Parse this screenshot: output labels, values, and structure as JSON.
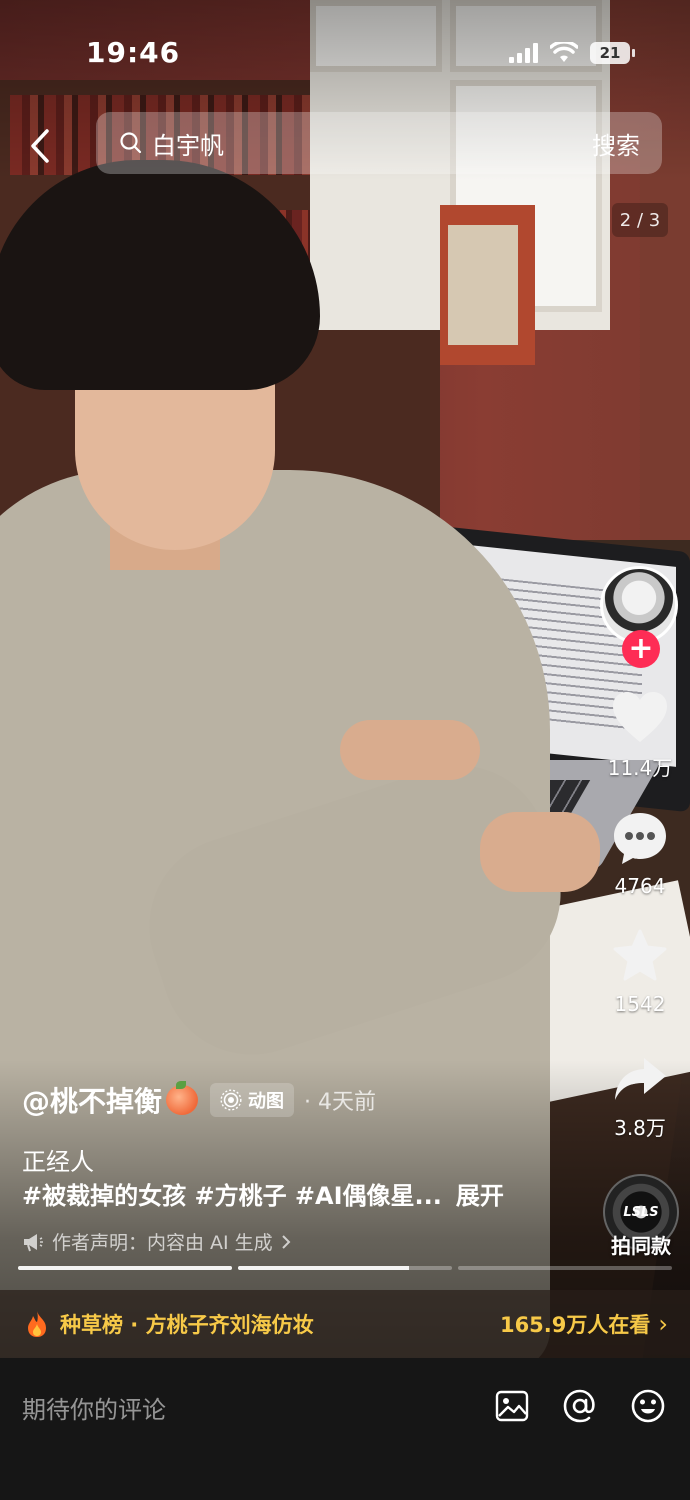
{
  "status": {
    "time": "19:46",
    "battery": "21"
  },
  "search": {
    "query": "白宇帆",
    "button_label": "搜索"
  },
  "page_indicator": "2 / 3",
  "rail": {
    "likes": "11.4万",
    "comments": "4764",
    "favorites": "1542",
    "shares": "3.8万",
    "same_style_label": "拍同款",
    "same_style_disc_text": "LSLS"
  },
  "post": {
    "author": "@桃不掉衡",
    "badge_label": "动图",
    "time_ago": "· 4天前",
    "title": "正经人",
    "tags": "#被裁掉的女孩 #方桃子 #AI偶像星...",
    "expand_label": "展开",
    "ai_note": "作者声明：内容由 AI 生成"
  },
  "progress": {
    "segments": 3,
    "current": 2,
    "current_fill_pct": 80
  },
  "banner": {
    "title": "种草榜 · 方桃子齐刘海仿妆",
    "viewers": "165.9万人在看"
  },
  "comment": {
    "placeholder": "期待你的评论"
  },
  "colors": {
    "like_red": "#fe2c55",
    "banner_gold": "#f7c948"
  }
}
